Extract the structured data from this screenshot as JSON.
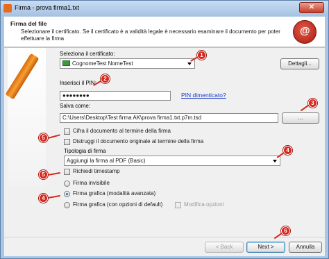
{
  "window": {
    "title": "Firma - prova firma1.txt",
    "close_symbol": "✕"
  },
  "header": {
    "title": "Firma del file",
    "description": "Selezionare il certificato. Se il certificato è a validità legale è necessario esaminare il documento per poter effettuare la firma"
  },
  "certificate": {
    "label": "Seleziona il certificato:",
    "selected": "CognomeTest NomeTest",
    "details_button": "Dettagli..."
  },
  "pin": {
    "label": "Inserisci il PIN:",
    "value": "●●●●●●●●",
    "forgot_link": "PIN dimenticato?"
  },
  "save_as": {
    "label": "Salva come:",
    "path": "C:\\Users\\Desktop\\Test firma AK\\prova firma1.txt.p7m.tsd",
    "browse_button": "..."
  },
  "options": {
    "encrypt": "Cifra il documento al termine della firma",
    "destroy_original": "Distruggi il documento originale al termine della firma"
  },
  "signature_type": {
    "label": "Tipologia di firma",
    "selected": "Aggiungi la firma al PDF (Basic)",
    "timestamp": "Richiedi timestamp",
    "radio_invisible": "Firma invisibile",
    "radio_graphic_advanced": "Firma grafica (modalità avanzata)",
    "radio_graphic_default": "Firma grafica (con opzioni di default)",
    "modify_options": "Modifica opzioni",
    "selected_radio": "radio_graphic_advanced"
  },
  "footer": {
    "back_button": "< Back",
    "next_button": "Next >",
    "cancel_button": "Annulla"
  },
  "markers": [
    "1",
    "2",
    "3",
    "4",
    "5",
    "6",
    "5",
    "4"
  ],
  "colors": {
    "accent": "#d8261c",
    "window_frame": "#a9c6e6",
    "link": "#1a3cc8"
  }
}
